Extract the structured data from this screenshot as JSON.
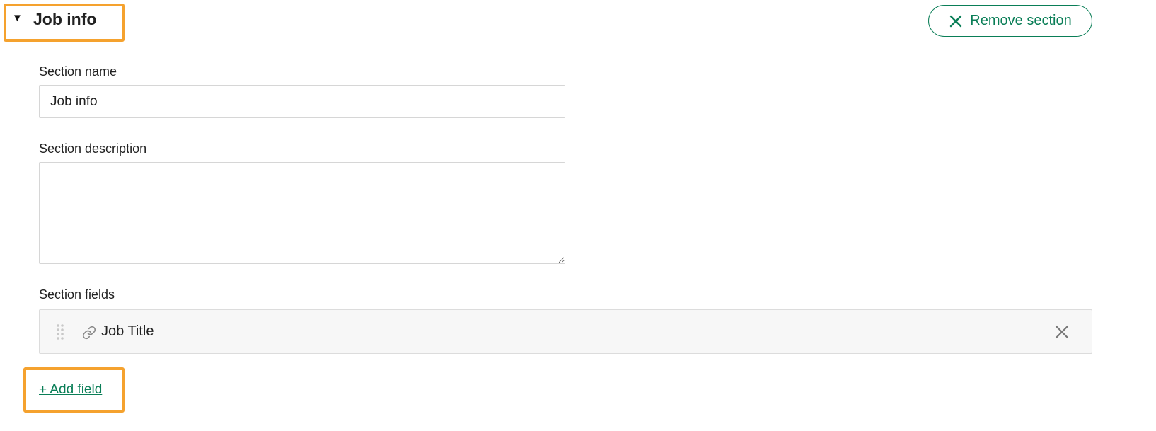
{
  "section": {
    "title": "Job info",
    "remove_label": "Remove section"
  },
  "form": {
    "name_label": "Section name",
    "name_value": "Job info",
    "description_label": "Section description",
    "description_value": "",
    "fields_label": "Section fields"
  },
  "fields": [
    {
      "label": "Job Title"
    }
  ],
  "add_field_label": "+ Add field",
  "colors": {
    "accent": "#0a7e57",
    "highlight": "#f5a22e",
    "field_row_bg": "#f7f7f7"
  },
  "icons": {
    "caret": "caret-down-icon",
    "remove": "close-icon",
    "drag": "drag-handle-icon",
    "link": "link-icon"
  }
}
